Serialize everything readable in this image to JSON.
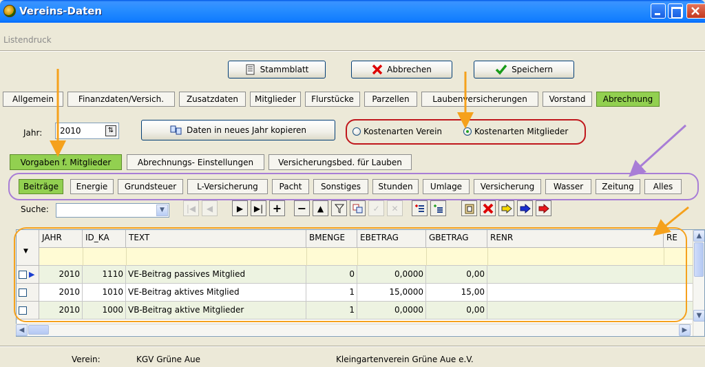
{
  "window": {
    "title": "Vereins-Daten",
    "menu": "Listendruck"
  },
  "buttons": {
    "stammblatt": "Stammblatt",
    "abbrechen": "Abbrechen",
    "speichern": "Speichern",
    "copy_year": "Daten in neues Jahr kopieren"
  },
  "main_tabs": [
    "Allgemein",
    "Finanzdaten/Versich.",
    "Zusatzdaten",
    "Mitglieder",
    "Flurstücke",
    "Parzellen",
    "Laubenversicherungen",
    "Vorstand",
    "Abrechnung"
  ],
  "main_tab_active": "Abrechnung",
  "year": {
    "label": "Jahr:",
    "value": "2010"
  },
  "radio": {
    "option1": "Kostenarten Verein",
    "option2": "Kostenarten Mitglieder",
    "selected": "Kostenarten Mitglieder"
  },
  "sub_tabs": [
    "Vorgaben f. Mitglieder",
    "Abrechnungs- Einstellungen",
    "Versicherungsbed. für Lauben"
  ],
  "sub_tab_active": "Vorgaben f. Mitglieder",
  "cat_tabs": [
    "Beiträge",
    "Energie",
    "Grundsteuer",
    "L-Versicherung",
    "Pacht",
    "Sonstiges",
    "Stunden",
    "Umlage",
    "Versicherung",
    "Wasser",
    "Zeitung",
    "Alles"
  ],
  "cat_tab_active": "Beiträge",
  "search": {
    "label": "Suche:"
  },
  "grid": {
    "columns": [
      "JAHR",
      "ID_KA",
      "TEXT",
      "BMENGE",
      "EBETRAG",
      "GBETRAG",
      "RENR",
      "RE"
    ],
    "rows": [
      [
        "2010",
        "1110",
        "VE-Beitrag passives Mitglied",
        "0",
        "0,0000",
        "0,00",
        ""
      ],
      [
        "2010",
        "1010",
        "VE-Beitrag aktives Mitglied",
        "1",
        "15,0000",
        "15,00",
        ""
      ],
      [
        "2010",
        "1000",
        "VB-Beitrag aktive Mitglieder",
        "1",
        "0,0000",
        "0,00",
        ""
      ]
    ]
  },
  "status": {
    "label": "Verein:",
    "short_name": "KGV Grüne Aue",
    "long_name": "Kleingartenverein Grüne Aue e.V."
  },
  "colors": {
    "active_tab": "#92d050",
    "annotation_orange": "#f5a11c",
    "annotation_purple": "#a87dd6",
    "annotation_red": "#c0161b",
    "row_green": "#edf3e1",
    "row_yellow": "#fffbd4"
  }
}
